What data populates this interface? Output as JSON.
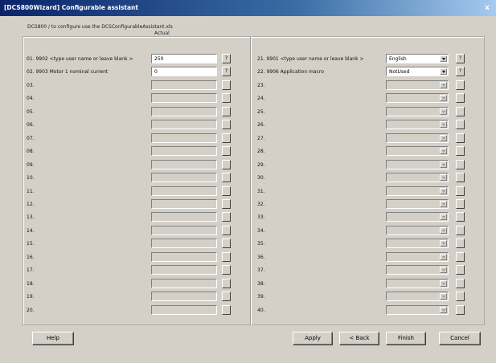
{
  "window": {
    "title": "[DCS800Wizard] Configurable assistant",
    "close": "x"
  },
  "intro": "DCS800 / to configure use the DCSConfigurableAssistant.xls",
  "column_header": "Actual",
  "left_rows": [
    {
      "label": "01. 9902 <type user name or leave blank >",
      "value": "250",
      "active": true,
      "button": "?"
    },
    {
      "label": "02. 9903 Motor 1 nominal current",
      "value": "0",
      "active": true,
      "button": "?"
    },
    {
      "label": "03.",
      "value": "",
      "active": false,
      "button": ""
    },
    {
      "label": "04.",
      "value": "",
      "active": false,
      "button": ""
    },
    {
      "label": "05.",
      "value": "",
      "active": false,
      "button": ""
    },
    {
      "label": "06.",
      "value": "",
      "active": false,
      "button": ""
    },
    {
      "label": "07.",
      "value": "",
      "active": false,
      "button": ""
    },
    {
      "label": "08.",
      "value": "",
      "active": false,
      "button": ""
    },
    {
      "label": "09.",
      "value": "",
      "active": false,
      "button": ""
    },
    {
      "label": "10.",
      "value": "",
      "active": false,
      "button": ""
    },
    {
      "label": "11.",
      "value": "",
      "active": false,
      "button": ""
    },
    {
      "label": "12.",
      "value": "",
      "active": false,
      "button": ""
    },
    {
      "label": "13.",
      "value": "",
      "active": false,
      "button": ""
    },
    {
      "label": "14.",
      "value": "",
      "active": false,
      "button": ""
    },
    {
      "label": "15.",
      "value": "",
      "active": false,
      "button": ""
    },
    {
      "label": "16.",
      "value": "",
      "active": false,
      "button": ""
    },
    {
      "label": "17.",
      "value": "",
      "active": false,
      "button": ""
    },
    {
      "label": "18.",
      "value": "",
      "active": false,
      "button": ""
    },
    {
      "label": "19.",
      "value": "",
      "active": false,
      "button": ""
    },
    {
      "label": "20.",
      "value": "",
      "active": false,
      "button": ""
    }
  ],
  "right_rows": [
    {
      "label": "21. 9901 <type user name or leave blank >",
      "value": "English",
      "active": true,
      "button": "?"
    },
    {
      "label": "22. 9906 Application macro",
      "value": "NotUsed",
      "active": true,
      "button": "?"
    },
    {
      "label": "23.",
      "value": "",
      "active": false,
      "button": ""
    },
    {
      "label": "24.",
      "value": "",
      "active": false,
      "button": ""
    },
    {
      "label": "25.",
      "value": "",
      "active": false,
      "button": ""
    },
    {
      "label": "26.",
      "value": "",
      "active": false,
      "button": ""
    },
    {
      "label": "27.",
      "value": "",
      "active": false,
      "button": ""
    },
    {
      "label": "28.",
      "value": "",
      "active": false,
      "button": ""
    },
    {
      "label": "29.",
      "value": "",
      "active": false,
      "button": ""
    },
    {
      "label": "30.",
      "value": "",
      "active": false,
      "button": ""
    },
    {
      "label": "31.",
      "value": "",
      "active": false,
      "button": ""
    },
    {
      "label": "32.",
      "value": "",
      "active": false,
      "button": ""
    },
    {
      "label": "33.",
      "value": "",
      "active": false,
      "button": ""
    },
    {
      "label": "34.",
      "value": "",
      "active": false,
      "button": ""
    },
    {
      "label": "35.",
      "value": "",
      "active": false,
      "button": ""
    },
    {
      "label": "36.",
      "value": "",
      "active": false,
      "button": ""
    },
    {
      "label": "37.",
      "value": "",
      "active": false,
      "button": ""
    },
    {
      "label": "38.",
      "value": "",
      "active": false,
      "button": ""
    },
    {
      "label": "39.",
      "value": "",
      "active": false,
      "button": ""
    },
    {
      "label": "40.",
      "value": "",
      "active": false,
      "button": ""
    }
  ],
  "buttons": {
    "help": "Help",
    "apply": "Apply",
    "back": "< Back",
    "finish": "Finish",
    "cancel": "Cancel"
  }
}
